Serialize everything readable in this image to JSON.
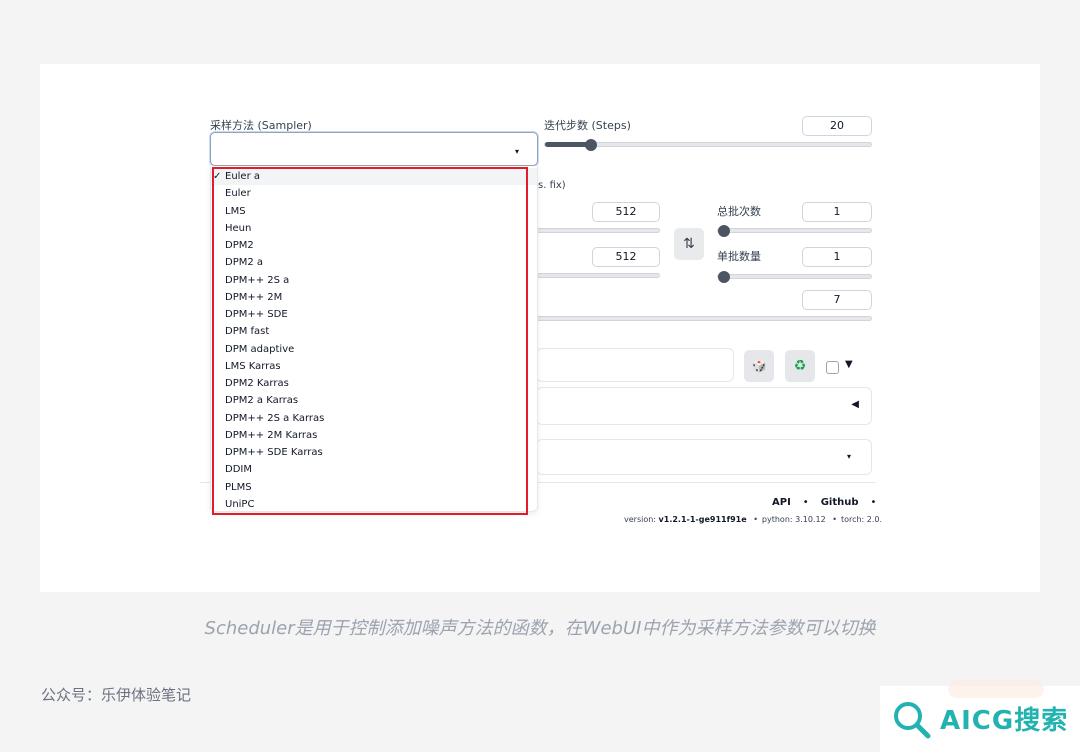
{
  "sampler": {
    "label": "采样方法 (Sampler)",
    "caret": "▾",
    "check": "✓",
    "options": [
      "Euler a",
      "Euler",
      "LMS",
      "Heun",
      "DPM2",
      "DPM2 a",
      "DPM++ 2S a",
      "DPM++ 2M",
      "DPM++ SDE",
      "DPM fast",
      "DPM adaptive",
      "LMS Karras",
      "DPM2 Karras",
      "DPM2 a Karras",
      "DPM++ 2S a Karras",
      "DPM++ 2M Karras",
      "DPM++ SDE Karras",
      "DDIM",
      "PLMS",
      "UniPC"
    ],
    "selected": "Euler a"
  },
  "steps": {
    "label": "迭代步数 (Steps)",
    "value": "20",
    "fraction": 0.12
  },
  "hires_fragment": "s. fix)",
  "width": {
    "value": "512"
  },
  "height": {
    "value": "512"
  },
  "swap_icon": "⇅",
  "batch_count": {
    "label": "总批次数",
    "value": "1",
    "fraction": 0.0
  },
  "batch_size": {
    "label": "单批数量",
    "value": "1",
    "fraction": 0.0
  },
  "cfg": {
    "value": "7"
  },
  "seed": {
    "dice_icon": "🎲",
    "recycle_icon": "♻",
    "extra_toggle": "▼"
  },
  "script_panel": {
    "arrow": "◀"
  },
  "script_select": {
    "caret": "▾"
  },
  "footer": {
    "links": [
      "API",
      "Github"
    ],
    "separator": "•",
    "version_label": "version: ",
    "version_value": "v1.2.1-1-ge911f91e",
    "python": "python: 3.10.12",
    "torch": "torch: 2.0."
  },
  "caption": "Scheduler是用于控制添加噪声方法的函数，在WebUI中作为采样方法参数可以切换",
  "account": "公众号：乐伊体验笔记",
  "watermark": {
    "text": "AICG搜索",
    "color": "#22b3b0"
  }
}
